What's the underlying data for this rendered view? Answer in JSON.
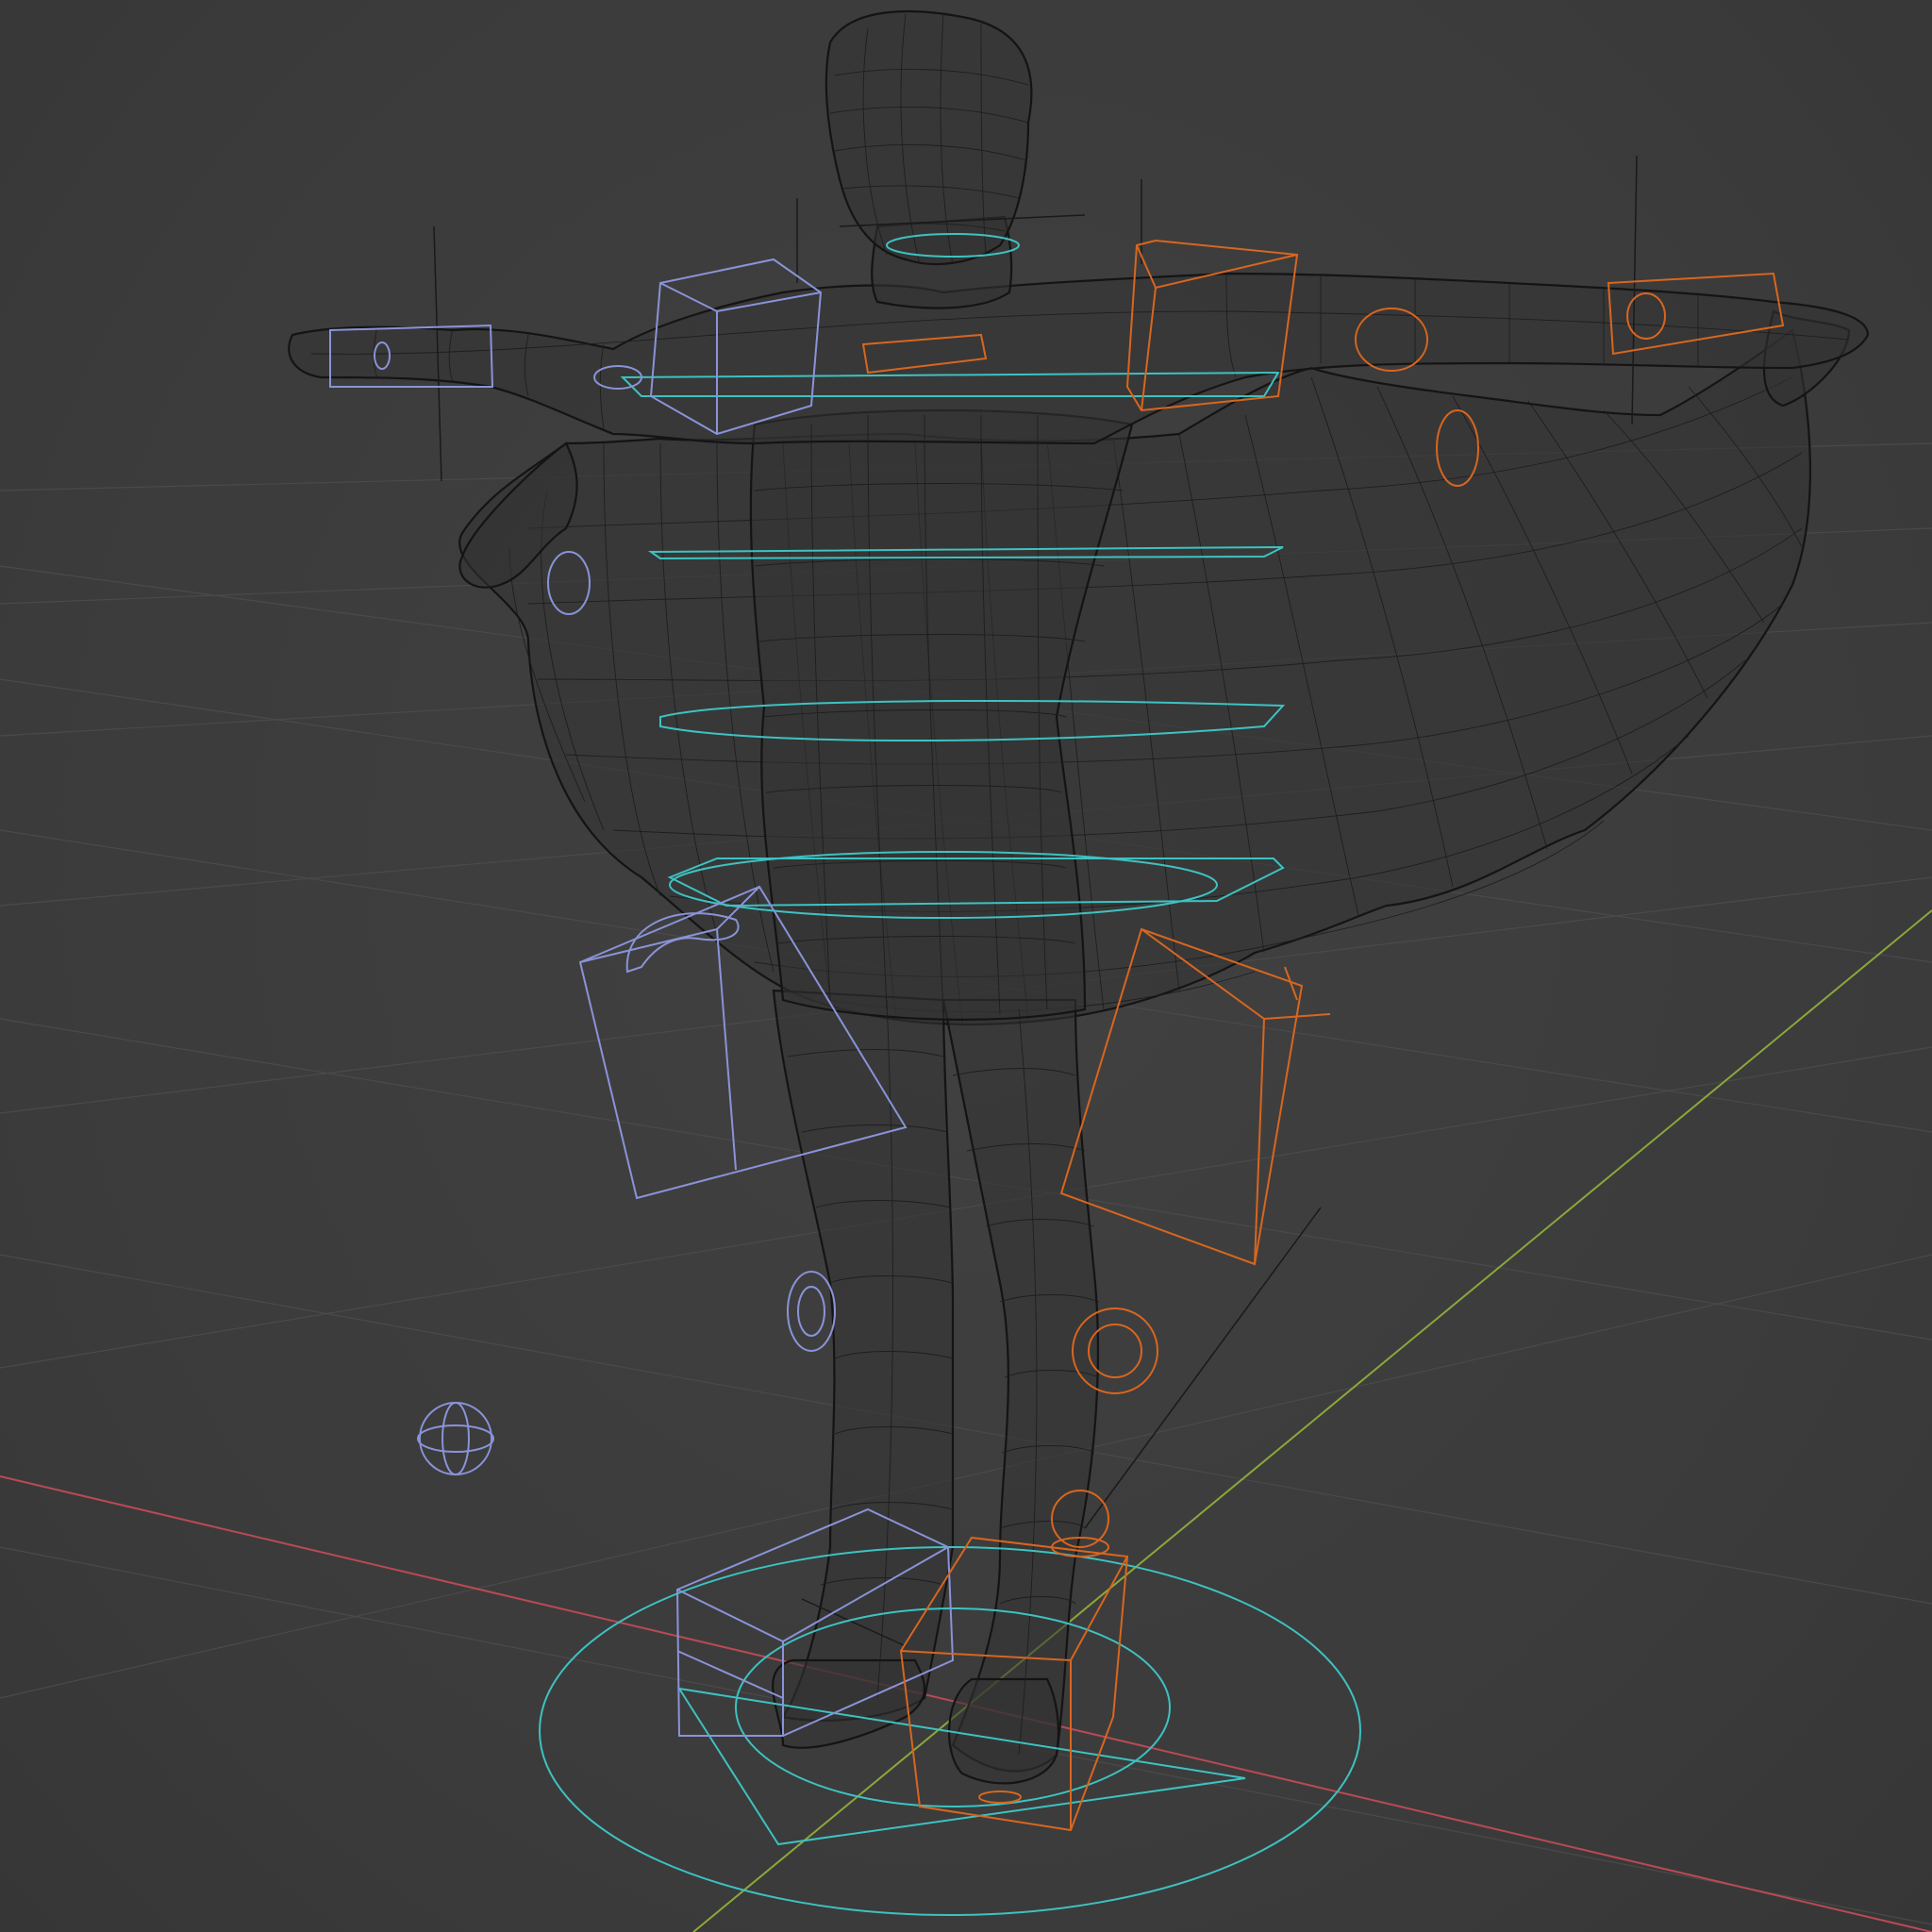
{
  "viewport": {
    "mode": "wireframe",
    "object": "rigged-character-with-cape",
    "colors": {
      "background": "#3d3d3d",
      "grid": "#4a4a4a",
      "x_axis": "#b94a55",
      "y_axis": "#8aa83a",
      "mesh_wire": "#151515",
      "control_left": "#8a93d8",
      "control_right": "#d8661f",
      "control_center": "#3ec2c2"
    },
    "icons": [
      "axis-gizmo",
      "bone-controls"
    ]
  }
}
